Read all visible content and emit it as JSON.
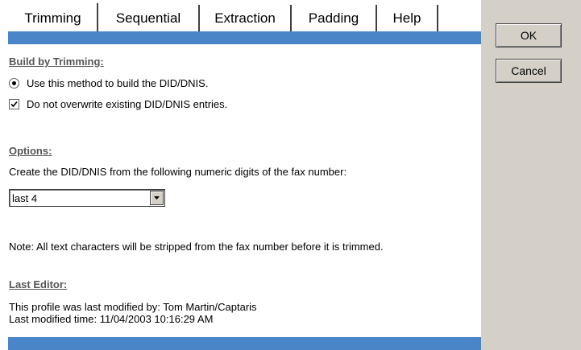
{
  "tabs": [
    {
      "label": "Trimming",
      "active": true
    },
    {
      "label": "Sequential",
      "active": false
    },
    {
      "label": "Extraction",
      "active": false
    },
    {
      "label": "Padding",
      "active": false
    },
    {
      "label": "Help",
      "active": false
    }
  ],
  "buttons": {
    "ok": "OK",
    "cancel": "Cancel"
  },
  "trimming": {
    "title": "Build by Trimming:",
    "radio_label": "Use this method to build the DID/DNIS.",
    "radio_checked": true,
    "checkbox_label": "Do not overwrite existing DID/DNIS entries.",
    "checkbox_checked": true
  },
  "options": {
    "title": "Options:",
    "description": "Create the DID/DNIS from the following numeric digits of the fax number:",
    "select_value": "last 4",
    "note": "Note: All text characters will be stripped from the fax number before it is trimmed."
  },
  "editor": {
    "title": "Last Editor:",
    "modified_by": "This profile was last modified by: Tom Martin/Captaris",
    "modified_time": "Last modified time: 11/04/2003 10:16:29 AM"
  },
  "colors": {
    "accent_bar": "#4a85c8",
    "panel_bg": "#d4d0c8"
  }
}
